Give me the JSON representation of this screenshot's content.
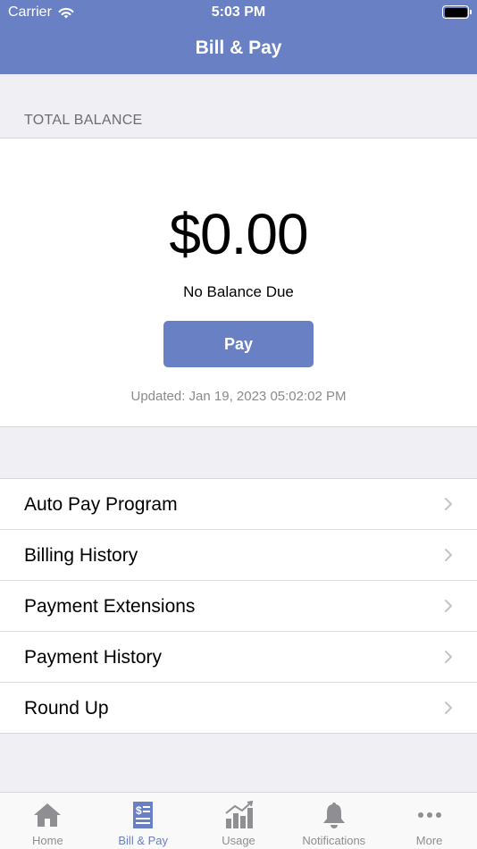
{
  "status_bar": {
    "carrier": "Carrier",
    "time": "5:03 PM"
  },
  "header": {
    "title": "Bill & Pay"
  },
  "balance": {
    "section_label": "TOTAL BALANCE",
    "amount": "$0.00",
    "status": "No Balance Due",
    "pay_label": "Pay",
    "updated": "Updated: Jan 19, 2023 05:02:02 PM"
  },
  "menu": {
    "items": [
      {
        "label": "Auto Pay Program"
      },
      {
        "label": "Billing History"
      },
      {
        "label": "Payment Extensions"
      },
      {
        "label": "Payment History"
      },
      {
        "label": "Round Up"
      }
    ]
  },
  "tabbar": {
    "active": "Bill & Pay",
    "tabs": [
      {
        "label": "Home",
        "icon": "home-icon"
      },
      {
        "label": "Bill & Pay",
        "icon": "bill-icon"
      },
      {
        "label": "Usage",
        "icon": "usage-chart-icon"
      },
      {
        "label": "Notifications",
        "icon": "bell-icon"
      },
      {
        "label": "More",
        "icon": "more-icon"
      }
    ]
  },
  "colors": {
    "brand": "#6a80c4",
    "inactive_tab": "#8e8e93",
    "background": "#efeff4"
  }
}
